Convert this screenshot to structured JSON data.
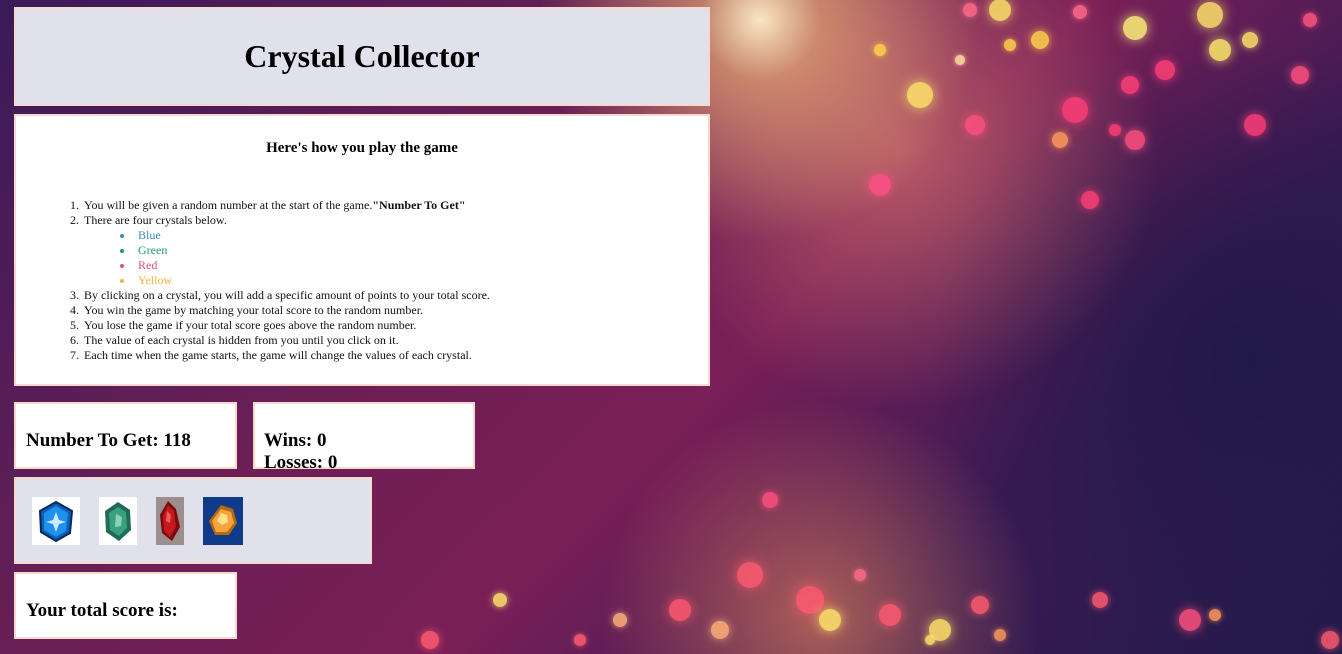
{
  "title": "Crystal Collector",
  "instructions": {
    "heading": "Here's how you play the game",
    "steps": [
      {
        "num": "1.",
        "text": "You will be given a random number at the start of the game.",
        "bold": "\"Number To Get\""
      },
      {
        "num": "2.",
        "text": "There are four crystals below."
      },
      {
        "num": "3.",
        "text": "By clicking on a crystal, you will add a specific amount of points to your total score."
      },
      {
        "num": "4.",
        "text": "You win the game by matching your total score to the random number."
      },
      {
        "num": "5.",
        "text": "You lose the game if your total score goes above the random number."
      },
      {
        "num": "6.",
        "text": "The value of each crystal is hidden from you until you click on it."
      },
      {
        "num": "7.",
        "text": "Each time when the game starts, the game will change the values of each crystal."
      }
    ],
    "crystal_colors": [
      "Blue",
      "Green",
      "Red",
      "Yellow"
    ]
  },
  "number_to_get": {
    "label": "Number To Get: 118"
  },
  "record": {
    "wins": "Wins: 0",
    "losses": "Losses: 0"
  },
  "crystals": [
    {
      "name": "blue-crystal",
      "color": "#1b7fd6"
    },
    {
      "name": "green-crystal",
      "color": "#2e8a6a"
    },
    {
      "name": "red-crystal",
      "color": "#b3161a"
    },
    {
      "name": "yellow-crystal",
      "color": "#f3a43a"
    }
  ],
  "score": {
    "label": "Your total score is:"
  }
}
